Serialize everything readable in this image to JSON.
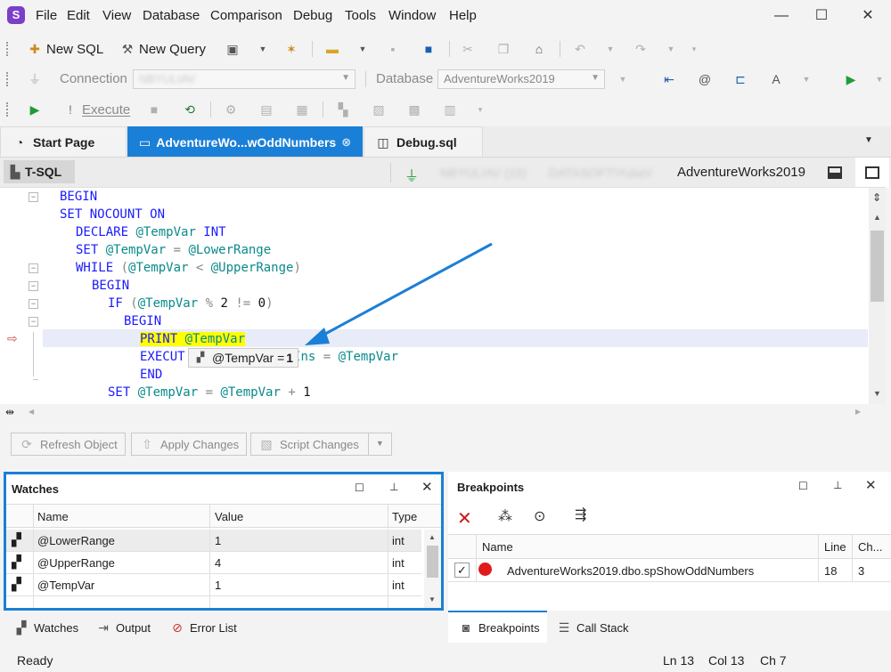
{
  "menu": {
    "logo": "S",
    "items": [
      "File",
      "Edit",
      "View",
      "Database",
      "Comparison",
      "Debug",
      "Tools",
      "Window",
      "Help"
    ]
  },
  "window_controls": {
    "minimize": "—",
    "maximize": "☐",
    "close": "✕"
  },
  "toolbar1": {
    "new_sql": "New SQL",
    "new_query": "New Query"
  },
  "toolbar2": {
    "connection_label": "Connection",
    "connection_value": "NBYULIAV",
    "database_label": "Database",
    "database_value": "AdventureWorks2019"
  },
  "toolbar3": {
    "execute": "Execute"
  },
  "doc_tabs": [
    {
      "label": "Start Page",
      "icon": "start-page-icon"
    },
    {
      "label": "AdventureWo...wOddNumbers",
      "icon": "procedure-icon",
      "active": true
    },
    {
      "label": "Debug.sql",
      "icon": "sql-file-icon"
    }
  ],
  "tsql": {
    "label": "T-SQL",
    "server": "NBYULIAV (15)",
    "user": "DATASOFT\\YuliaV",
    "database": "AdventureWorks2019"
  },
  "code": {
    "l1": "BEGIN",
    "l2a": "SET NOCOUNT ",
    "l2b": "ON",
    "l3a": "DECLARE ",
    "l3b": "@TempVar",
    "l3c": " INT",
    "l4a": "SET ",
    "l4b": "@TempVar",
    "l4c": " = ",
    "l4d": "@LowerRange",
    "l5a": "WHILE ",
    "l5b": "(",
    "l5c": "@TempVar",
    "l5d": " < ",
    "l5e": "@UpperRange",
    "l5f": ")",
    "l6": "BEGIN",
    "l7a": "IF ",
    "l7b": "(",
    "l7c": "@TempVar",
    "l7d": " % ",
    "l7e": "2",
    "l7f": " != ",
    "l7g": "0",
    "l7h": ")",
    "l8": "BEGIN",
    "l9a": "PRINT ",
    "l9b": "@TempVar",
    "l10a": "EXECUT",
    "l10b": "ers ",
    "l10c": "@VarIns",
    "l10d": " = ",
    "l10e": "@TempVar",
    "l11": "END",
    "l12a": "SET ",
    "l12b": "@TempVar",
    "l12c": " = ",
    "l12d": "@TempVar",
    "l12e": " + ",
    "l12f": "1"
  },
  "tooltip": {
    "name": "@TempVar = ",
    "value": "1"
  },
  "actions": {
    "refresh": "Refresh Object",
    "apply": "Apply Changes",
    "script": "Script Changes"
  },
  "watches": {
    "title": "Watches",
    "columns": [
      "Name",
      "Value",
      "Type"
    ],
    "rows": [
      {
        "name": "@LowerRange",
        "value": "1",
        "type": "int"
      },
      {
        "name": "@UpperRange",
        "value": "4",
        "type": "int"
      },
      {
        "name": "@TempVar",
        "value": "1",
        "type": "int"
      }
    ]
  },
  "breakpoints": {
    "title": "Breakpoints",
    "columns": [
      "Name",
      "Line",
      "Ch..."
    ],
    "rows": [
      {
        "name": "AdventureWorks2019.dbo.spShowOddNumbers",
        "line": "18",
        "ch": "3"
      }
    ]
  },
  "bottom_tabs_left": [
    "Watches",
    "Output",
    "Error List"
  ],
  "bottom_tabs_right": [
    "Breakpoints",
    "Call Stack"
  ],
  "status": {
    "left": "Ready",
    "ln": "Ln 13",
    "col": "Col 13",
    "ch": "Ch 7"
  },
  "colors": {
    "accent": "#1a7fd6",
    "highlight": "#ffff00",
    "breakpoint": "#e01b1b",
    "exec_line": "#e8ecf8"
  }
}
